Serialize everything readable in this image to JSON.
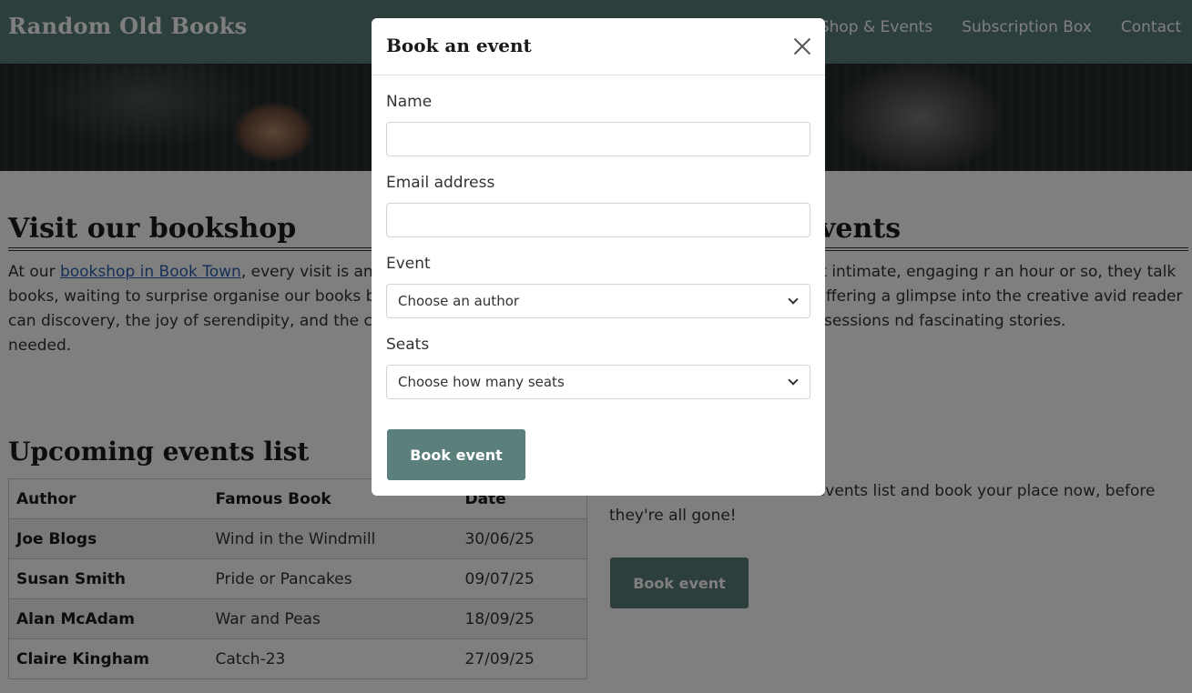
{
  "header": {
    "brand": "Random Old Books",
    "nav": [
      "Shop & Events",
      "Subscription Box",
      "Contact"
    ]
  },
  "visit": {
    "heading": "Visit our bookshop",
    "text_prefix": "At our ",
    "link": "bookshop in Book Town",
    "text_suffix": ", every visit is an a lined with random old books, waiting to surprise organise our books by genre or title, so you can discovery, the joy of serendipity, and the chance you never knew you needed."
  },
  "events_section": {
    "heading_fragment": "vents",
    "text": "o share their experiences at intimate, engaging r an hour or so, they talk about the struggles riting, offering a glimpse into the creative avid reader or an aspiring writer, these sessions nd fascinating stories."
  },
  "upcoming": {
    "heading": "Upcoming events list",
    "columns": [
      "Author",
      "Famous Book",
      "Date"
    ],
    "rows": [
      {
        "author": "Joe Blogs",
        "book": "Wind in the Windmill",
        "date": "30/06/25"
      },
      {
        "author": "Susan Smith",
        "book": "Pride or Pancakes",
        "date": "09/07/25"
      },
      {
        "author": "Alan McAdam",
        "book": "War and Peas",
        "date": "18/09/25"
      },
      {
        "author": "Claire Kingham",
        "book": "Catch-23",
        "date": "27/09/25"
      }
    ]
  },
  "booking": {
    "text": "Choose an event from the events list and book your place now, before they're all gone!",
    "button": "Book event"
  },
  "modal": {
    "title": "Book an event",
    "name_label": "Name",
    "name_value": "",
    "email_label": "Email address",
    "email_value": "",
    "event_label": "Event",
    "event_selected": "Choose an author",
    "seats_label": "Seats",
    "seats_selected": "Choose how many seats",
    "submit": "Book event"
  },
  "colors": {
    "brand": "#5b7f7b",
    "link": "#2a5db0",
    "backdrop": "rgba(0,0,0,0.5)"
  },
  "icons": {
    "close": "close-icon",
    "select_chevron": "chevron-down-icon"
  }
}
